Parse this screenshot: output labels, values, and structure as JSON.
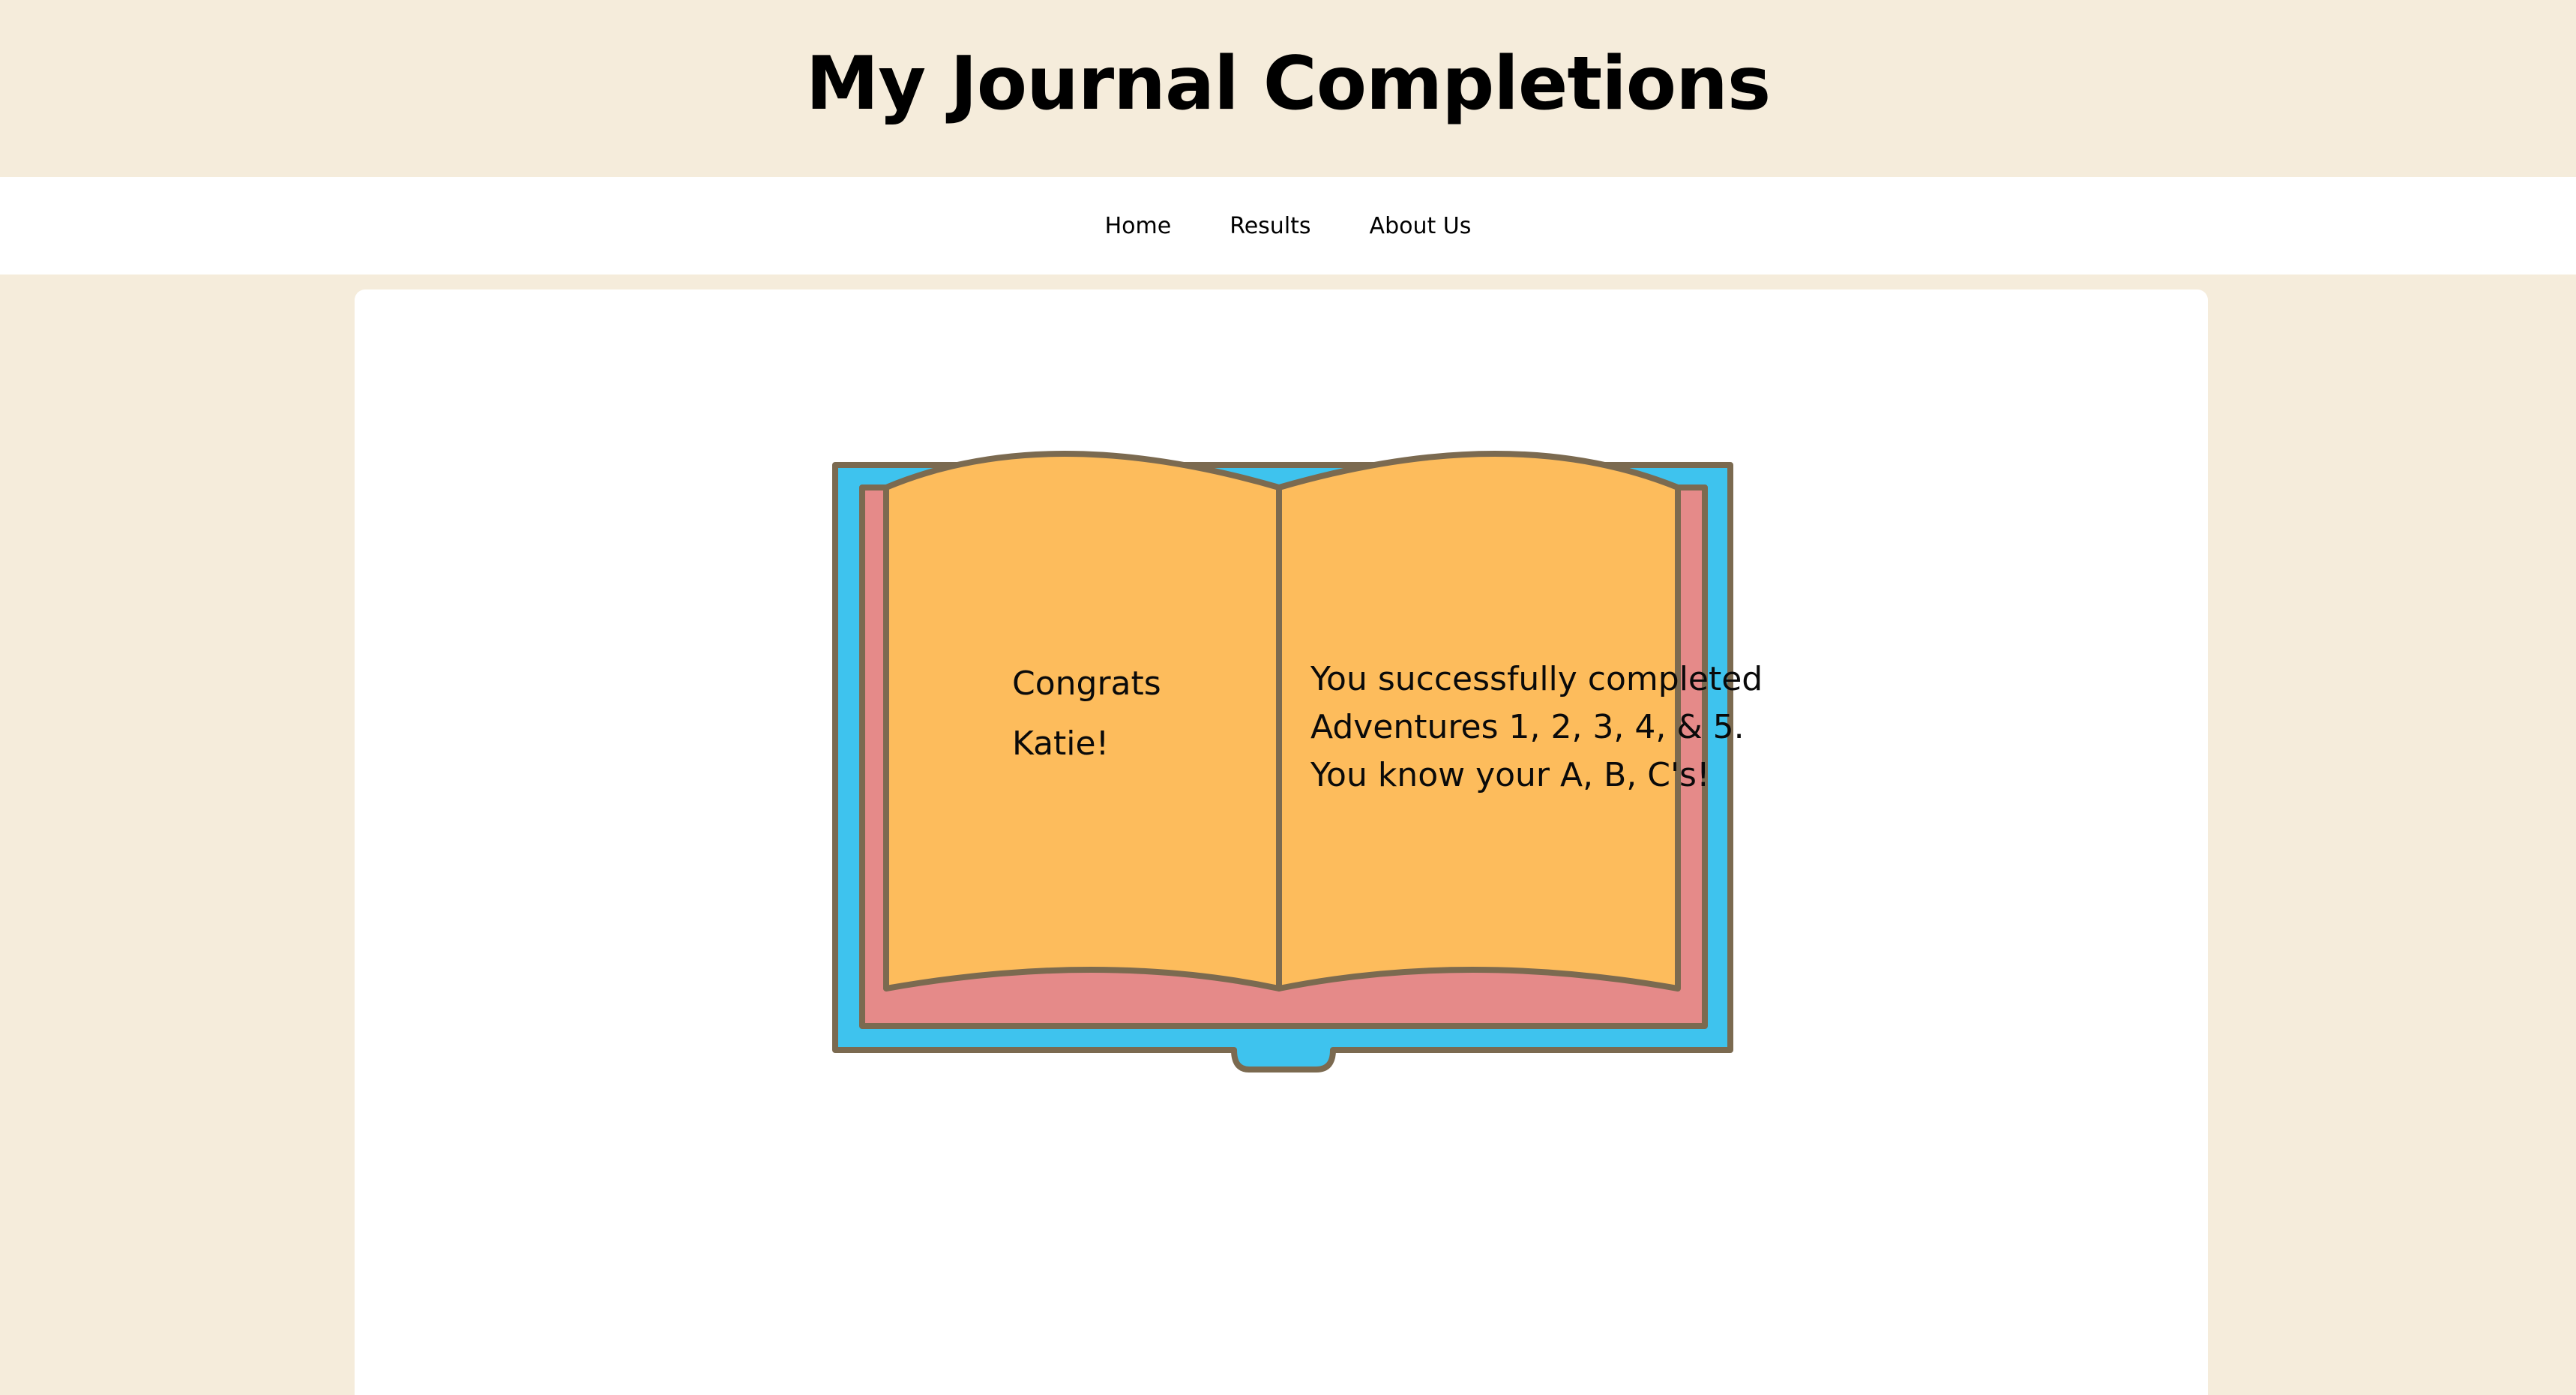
{
  "header": {
    "title": "My Journal Completions"
  },
  "nav": {
    "items": [
      "Home",
      "Results",
      "About Us"
    ]
  },
  "book": {
    "left_page": {
      "line1": "Congrats",
      "line2": "Katie!"
    },
    "right_page": {
      "line1": "You successfully completed",
      "line2": "Adventures 1, 2, 3, 4, & 5.",
      "line3": "You know your A, B, C's!"
    }
  },
  "colors": {
    "background": "#f5ecdb",
    "cover": "#3ec3ee",
    "page_edges": "#e58a89",
    "pages": "#fdbc5c",
    "outline": "#7b6a50"
  }
}
